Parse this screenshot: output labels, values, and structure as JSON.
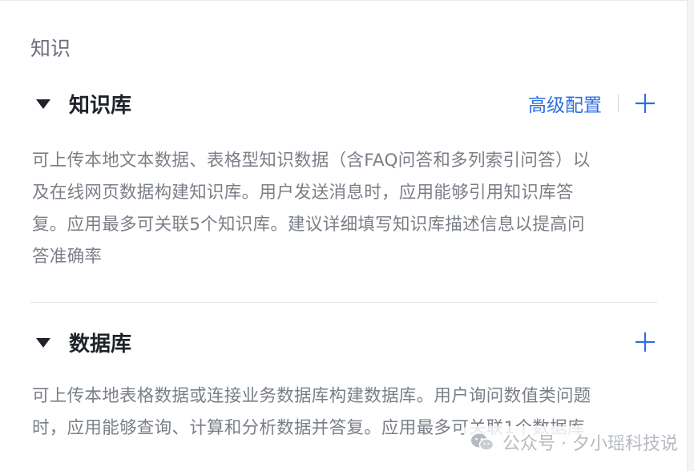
{
  "section": {
    "title": "知识"
  },
  "knowledge_base": {
    "title": "知识库",
    "advanced_link": "高级配置",
    "description_lines": [
      "可上传本地文本数据、表格型知识数据（含FAQ问答和多列索引问答）以",
      "及在线网页数据构建知识库。用户发送消息时，应用能够引用知识库答",
      "复。应用最多可关联5个知识库。建议详细填写知识库描述信息以提高问",
      "答准确率"
    ]
  },
  "database": {
    "title": "数据库",
    "description_lines": [
      "可上传本地表格数据或连接业务数据库构建数据库。用户询问数值类问题",
      "时，应用能够查询、计算和分析数据并答复。应用最多可关联1个数据库"
    ]
  },
  "watermark": {
    "text": "公众号 · 夕小瑶科技说"
  },
  "icons": {
    "collapse": "caret-down-icon",
    "add": "plus-icon",
    "watermark_logo": "wechat-icon"
  },
  "colors": {
    "accent": "#2f6ee0",
    "title_text": "#1f2329",
    "muted_text": "#7a7f87"
  }
}
